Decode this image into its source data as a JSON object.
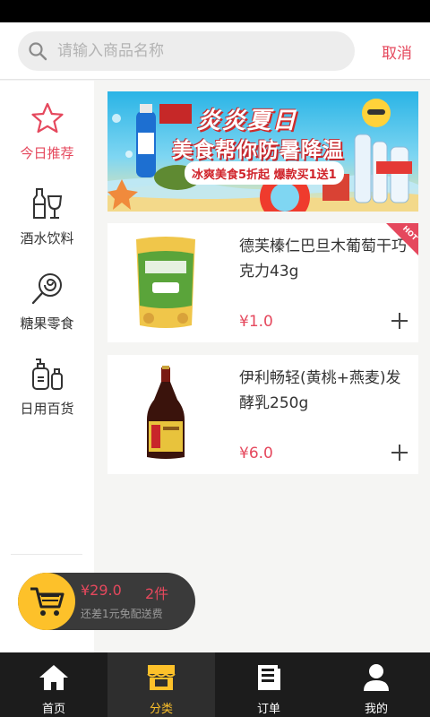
{
  "search": {
    "placeholder": "请输入商品名称",
    "cancel_label": "取消"
  },
  "sidebar": {
    "items": [
      {
        "label": "今日推荐",
        "icon": "star-icon",
        "active": true
      },
      {
        "label": "酒水饮料",
        "icon": "bottle-glass-icon",
        "active": false
      },
      {
        "label": "糖果零食",
        "icon": "lollipop-icon",
        "active": false
      },
      {
        "label": "日用百货",
        "icon": "toiletries-icon",
        "active": false
      }
    ]
  },
  "banner": {
    "title": "炎炎夏日",
    "subtitle": "美食帮你防暑降温",
    "promo": "冰爽美食5折起 爆款买1送1"
  },
  "products": [
    {
      "name": "德芙榛仁巴旦木葡萄干巧克力43g",
      "price": "¥1.0",
      "badge": "HOT",
      "image": "millet-crisp-snack-bag"
    },
    {
      "name": "伊利畅轻(黄桃+燕麦)发酵乳250g",
      "price": "¥6.0",
      "image": "soy-sauce-bottle"
    }
  ],
  "cart": {
    "total": "¥29.0",
    "count": "2件",
    "hint": "还差1元免配送费"
  },
  "tabbar": {
    "tabs": [
      {
        "label": "首页",
        "icon": "home-icon",
        "active": false
      },
      {
        "label": "分类",
        "icon": "store-icon",
        "active": true
      },
      {
        "label": "订单",
        "icon": "order-list-icon",
        "active": false
      },
      {
        "label": "我的",
        "icon": "user-icon",
        "active": false
      }
    ]
  },
  "colors": {
    "accent": "#e5485d",
    "cart_yellow": "#fdc12a",
    "tabbar_bg": "#1c1c1c"
  }
}
